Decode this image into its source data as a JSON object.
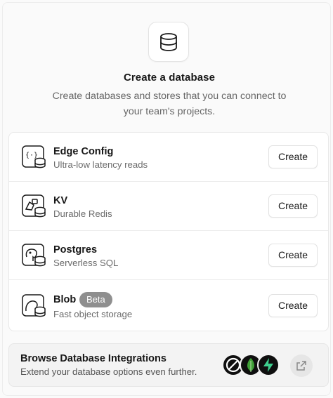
{
  "header": {
    "title": "Create a database",
    "subtitle": "Create databases and stores that you can connect to your team's projects.",
    "icon": "database-icon"
  },
  "stores": [
    {
      "name": "Edge Config",
      "description": "Ultra-low latency reads",
      "badge": "",
      "button_label": "Create",
      "icon": "edge-config-icon"
    },
    {
      "name": "KV",
      "description": "Durable Redis",
      "badge": "",
      "button_label": "Create",
      "icon": "kv-icon"
    },
    {
      "name": "Postgres",
      "description": "Serverless SQL",
      "badge": "",
      "button_label": "Create",
      "icon": "postgres-icon"
    },
    {
      "name": "Blob",
      "description": "Fast object storage",
      "badge": "Beta",
      "button_label": "Create",
      "icon": "blob-icon"
    }
  ],
  "integrations": {
    "title": "Browse Database Integrations",
    "subtitle": "Extend your database options even further.",
    "logos": [
      "planetscale-logo",
      "mongodb-logo",
      "supabase-logo"
    ],
    "external_link_icon": "external-link-icon"
  },
  "colors": {
    "background": "#fafafa",
    "text": "#171717",
    "muted": "#666666",
    "badge": "#8f8f8f",
    "mongodb_green": "#3fa037",
    "supabase_green": "#3ecf8e"
  }
}
